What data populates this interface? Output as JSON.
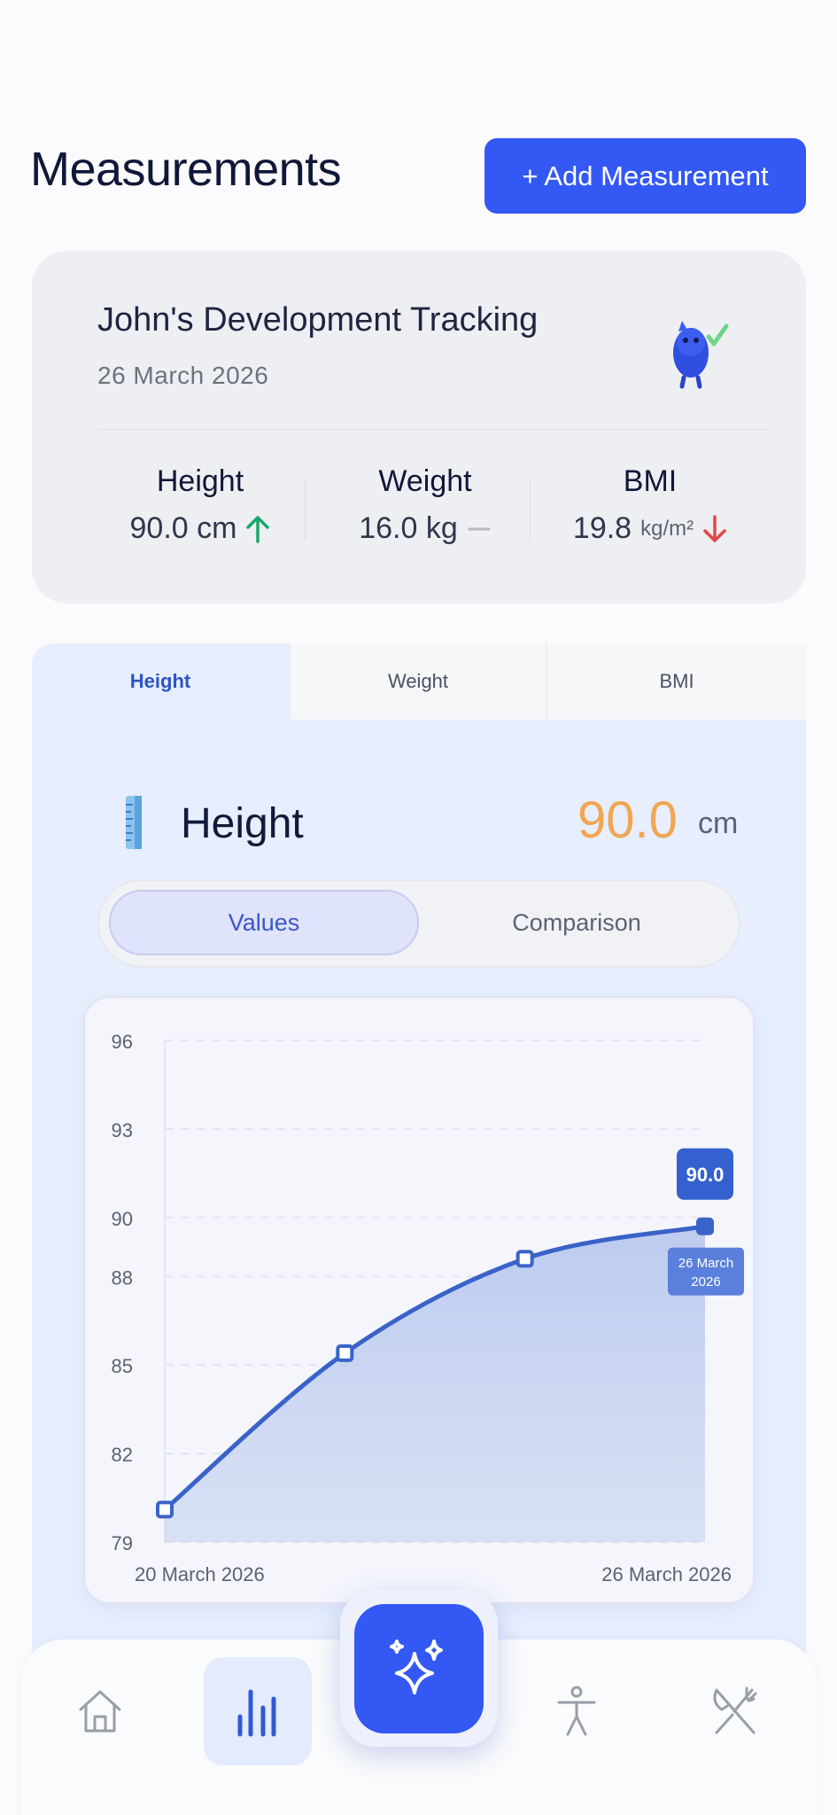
{
  "header": {
    "title": "Measurements",
    "add_button": "+ Add Measurement"
  },
  "summary": {
    "title": "John's Development Tracking",
    "date": "26 March 2026",
    "stats": [
      {
        "label": "Height",
        "value": "90.0 cm",
        "trend": "up"
      },
      {
        "label": "Weight",
        "value": "16.0 kg",
        "trend": "flat"
      },
      {
        "label": "BMI",
        "value": "19.8",
        "unit": "kg/m²",
        "trend": "down"
      }
    ]
  },
  "tabs": [
    {
      "label": "Height",
      "active": true
    },
    {
      "label": "Weight",
      "active": false
    },
    {
      "label": "BMI",
      "active": false
    }
  ],
  "metric": {
    "name": "Height",
    "value": "90.0",
    "unit": "cm"
  },
  "segmented": {
    "values": "Values",
    "comparison": "Comparison",
    "selected": "Values"
  },
  "chart_data": {
    "type": "area",
    "x": [
      "20 March 2026",
      "",
      "",
      "26 March 2026"
    ],
    "values": [
      80.1,
      85.4,
      88.6,
      89.7
    ],
    "y_ticks": [
      96,
      93,
      90,
      88,
      85,
      82,
      79
    ],
    "ylim": [
      79,
      96
    ],
    "x_tick_labels": [
      "20 March 2026",
      "26 March 2026"
    ],
    "tooltip": {
      "value": "90.0",
      "date": "26 March\n2026"
    },
    "grid": true,
    "color": "#3a63c9"
  },
  "nav": {
    "items": [
      "home-icon",
      "chart-icon",
      "sparkles-icon",
      "accessibility-icon",
      "utensils-icon"
    ],
    "active": "chart-icon"
  },
  "colors": {
    "accent": "#3358f4",
    "value_orange": "#f2a553",
    "up": "#18a86b",
    "down": "#e04848"
  }
}
